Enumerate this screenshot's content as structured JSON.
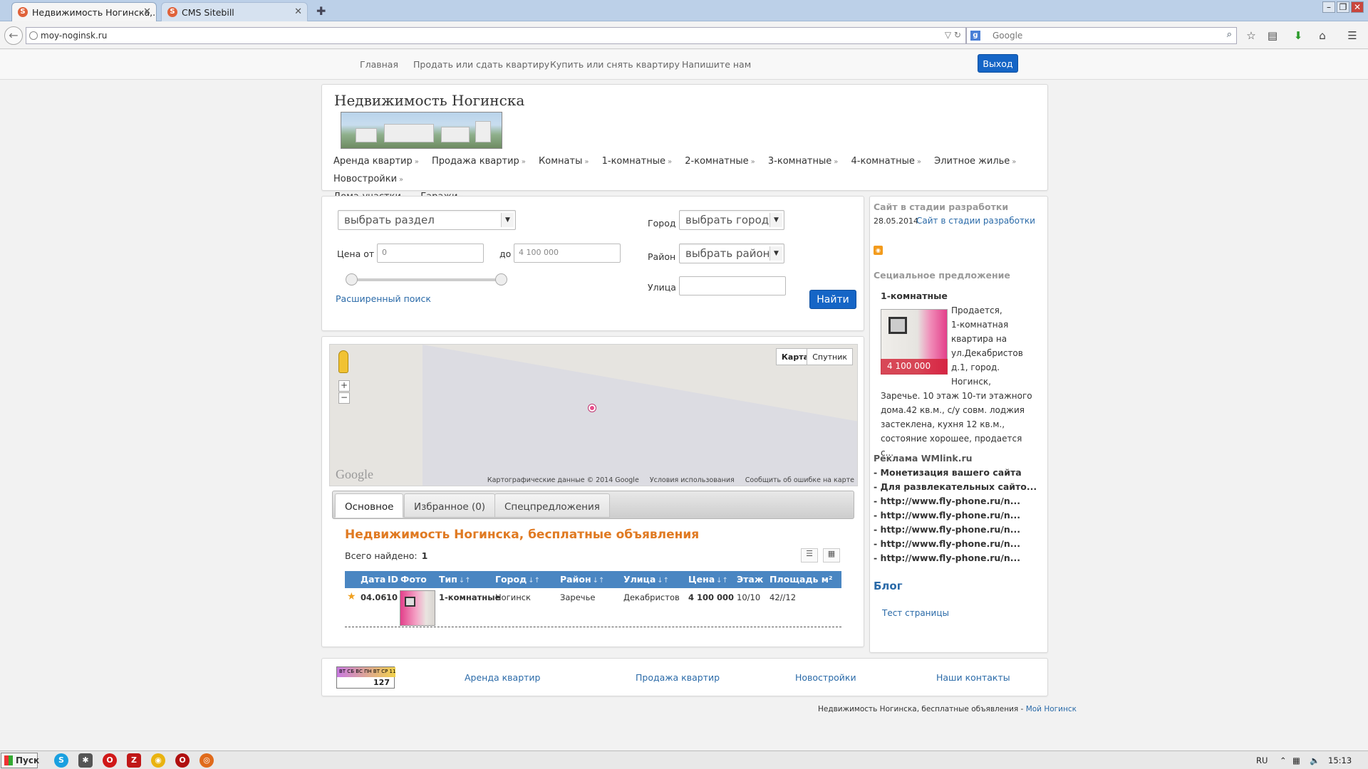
{
  "browser": {
    "tabs": [
      {
        "label": "Недвижимость Ногинска,...",
        "active": true
      },
      {
        "label": "CMS Sitebill",
        "active": false
      }
    ],
    "url": "moy-noginsk.ru",
    "search_placeholder": "Google",
    "window_buttons": [
      "–",
      "❐",
      "✕"
    ]
  },
  "site_nav": {
    "items": [
      "Главная",
      "Продать или сдать квартиру",
      "Купить или снять квартиру",
      "Напишите нам"
    ],
    "logout_label": "Выход"
  },
  "header": {
    "title": "Недвижимость Ногинска",
    "categories": [
      "Аренда квартир",
      "Продажа квартир",
      "Комнаты",
      "1-комнатные",
      "2-комнатные",
      "3-комнатные",
      "4-комнатные",
      "Элитное жилье",
      "Новостройки",
      "Дома-участки",
      "Гаражи"
    ],
    "chevron": "»"
  },
  "search": {
    "section_select": "выбрать раздел",
    "price_from_label": "Цена от",
    "price_from_value": "0",
    "price_to_label": "до",
    "price_to_value": "4 100 000",
    "advanced_link": "Расширенный поиск",
    "city_label": "Город",
    "city_select": "выбрать город",
    "district_label": "Район",
    "district_select": "выбрать район",
    "street_label": "Улица",
    "street_value": "",
    "submit_label": "Найти"
  },
  "map": {
    "type_map": "Карта",
    "type_satellite": "Спутник",
    "zoom_in": "+",
    "zoom_out": "−",
    "logo": "Google",
    "attribution": [
      "Картографические данные © 2014 Google",
      "Условия использования",
      "Сообщить об ошибке на карте"
    ]
  },
  "tabs": [
    "Основное",
    "Избранное (0)",
    "Спецпредложения"
  ],
  "listing": {
    "title": "Недвижимость Ногинска, бесплатные объявления",
    "found_label": "Всего найдено:",
    "found_count": "1",
    "columns": [
      "Дата",
      "ID",
      "Фото",
      "Тип",
      "Город",
      "Район",
      "Улица",
      "Цена",
      "Этаж",
      "Площадь м²"
    ],
    "sort_arrows": "↓↑",
    "rows": [
      {
        "date": "04.06",
        "id": "10",
        "type": "1-комнатные",
        "city": "Ногинск",
        "district": "Заречье",
        "street": "Декабристов",
        "price": "4 100 000",
        "floor": "10/10",
        "area": "42//12"
      }
    ]
  },
  "sidebar": {
    "news_heading": "Сайт в стадии разработки",
    "news_date": "28.05.2014",
    "news_link": "Сайт в стадии разработки",
    "special_heading": "Сециальное предложение",
    "special_category": "1-комнатные",
    "special_price": "4 100 000",
    "special_text_lines": [
      "Продается,",
      "1-комнатная",
      "квартира на",
      "ул.Декабристов",
      "д.1, город.",
      "Ногинск,"
    ],
    "special_text_wide": [
      "Заречье. 10 этаж 10-ти этажного",
      "дома.42 кв.м., с/у совм. лоджия",
      "застеклена, кухня 12 кв.м.,",
      "состояние хорошее, продается с..."
    ],
    "ads_heading": "Реклама WMlink.ru",
    "ads": [
      "- Монетизация вашего сайта",
      "- Для развлекательных сайто...",
      "- http://www.fly-phone.ru/n...",
      "- http://www.fly-phone.ru/n...",
      "- http://www.fly-phone.ru/n...",
      "- http://www.fly-phone.ru/n...",
      "- http://www.fly-phone.ru/n..."
    ],
    "blog_heading": "Блог",
    "blog_link": "Тест страницы"
  },
  "footer": {
    "counter_bar": "ВТ СБ ВС ПН ВТ СР 11",
    "counter_value": "127",
    "links": [
      "Аренда квартир",
      "Продажа квартир",
      "Новостройки",
      "Наши контакты"
    ],
    "copyright_text": "Недвижимость Ногинска, бесплатные объявления -",
    "copyright_link": "Мой Ногинск"
  },
  "taskbar": {
    "start_label": "Пуск",
    "lang": "RU",
    "time": "15:13"
  }
}
